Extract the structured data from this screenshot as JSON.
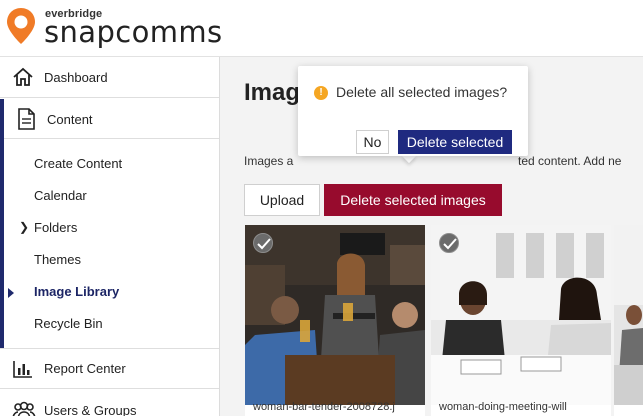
{
  "brand": {
    "company": "everbridge",
    "product": "snapcomms",
    "accent_color": "#f07b27"
  },
  "sidebar": {
    "dashboard": {
      "label": "Dashboard",
      "icon": "home-icon"
    },
    "content": {
      "label": "Content",
      "icon": "document-icon"
    },
    "items": [
      {
        "label": "Create Content"
      },
      {
        "label": "Calendar"
      },
      {
        "label": "Folders",
        "has_children": true
      },
      {
        "label": "Themes"
      },
      {
        "label": "Image Library",
        "active": true
      },
      {
        "label": "Recycle Bin"
      }
    ],
    "report_center": {
      "label": "Report Center",
      "icon": "bar-chart-icon"
    },
    "users_groups": {
      "label": "Users & Groups",
      "icon": "users-icon"
    },
    "active_color": "#1f2a6d"
  },
  "main": {
    "title": "Imag",
    "description_left": "Images a",
    "description_right": "ted content. Add ne",
    "upload_label": "Upload",
    "delete_images_label": "Delete selected images",
    "delete_color": "#970b2d",
    "images": [
      {
        "caption": "woman-bar-tender-2008728.j",
        "selected": true
      },
      {
        "caption": "woman-doing-meeting-will",
        "selected": true
      },
      {
        "caption": "",
        "selected": false
      }
    ]
  },
  "popover": {
    "message": "Delete all selected images?",
    "icon": "warning-icon",
    "cancel_label": "No",
    "confirm_label": "Delete selected",
    "confirm_color": "#1f2a80"
  }
}
